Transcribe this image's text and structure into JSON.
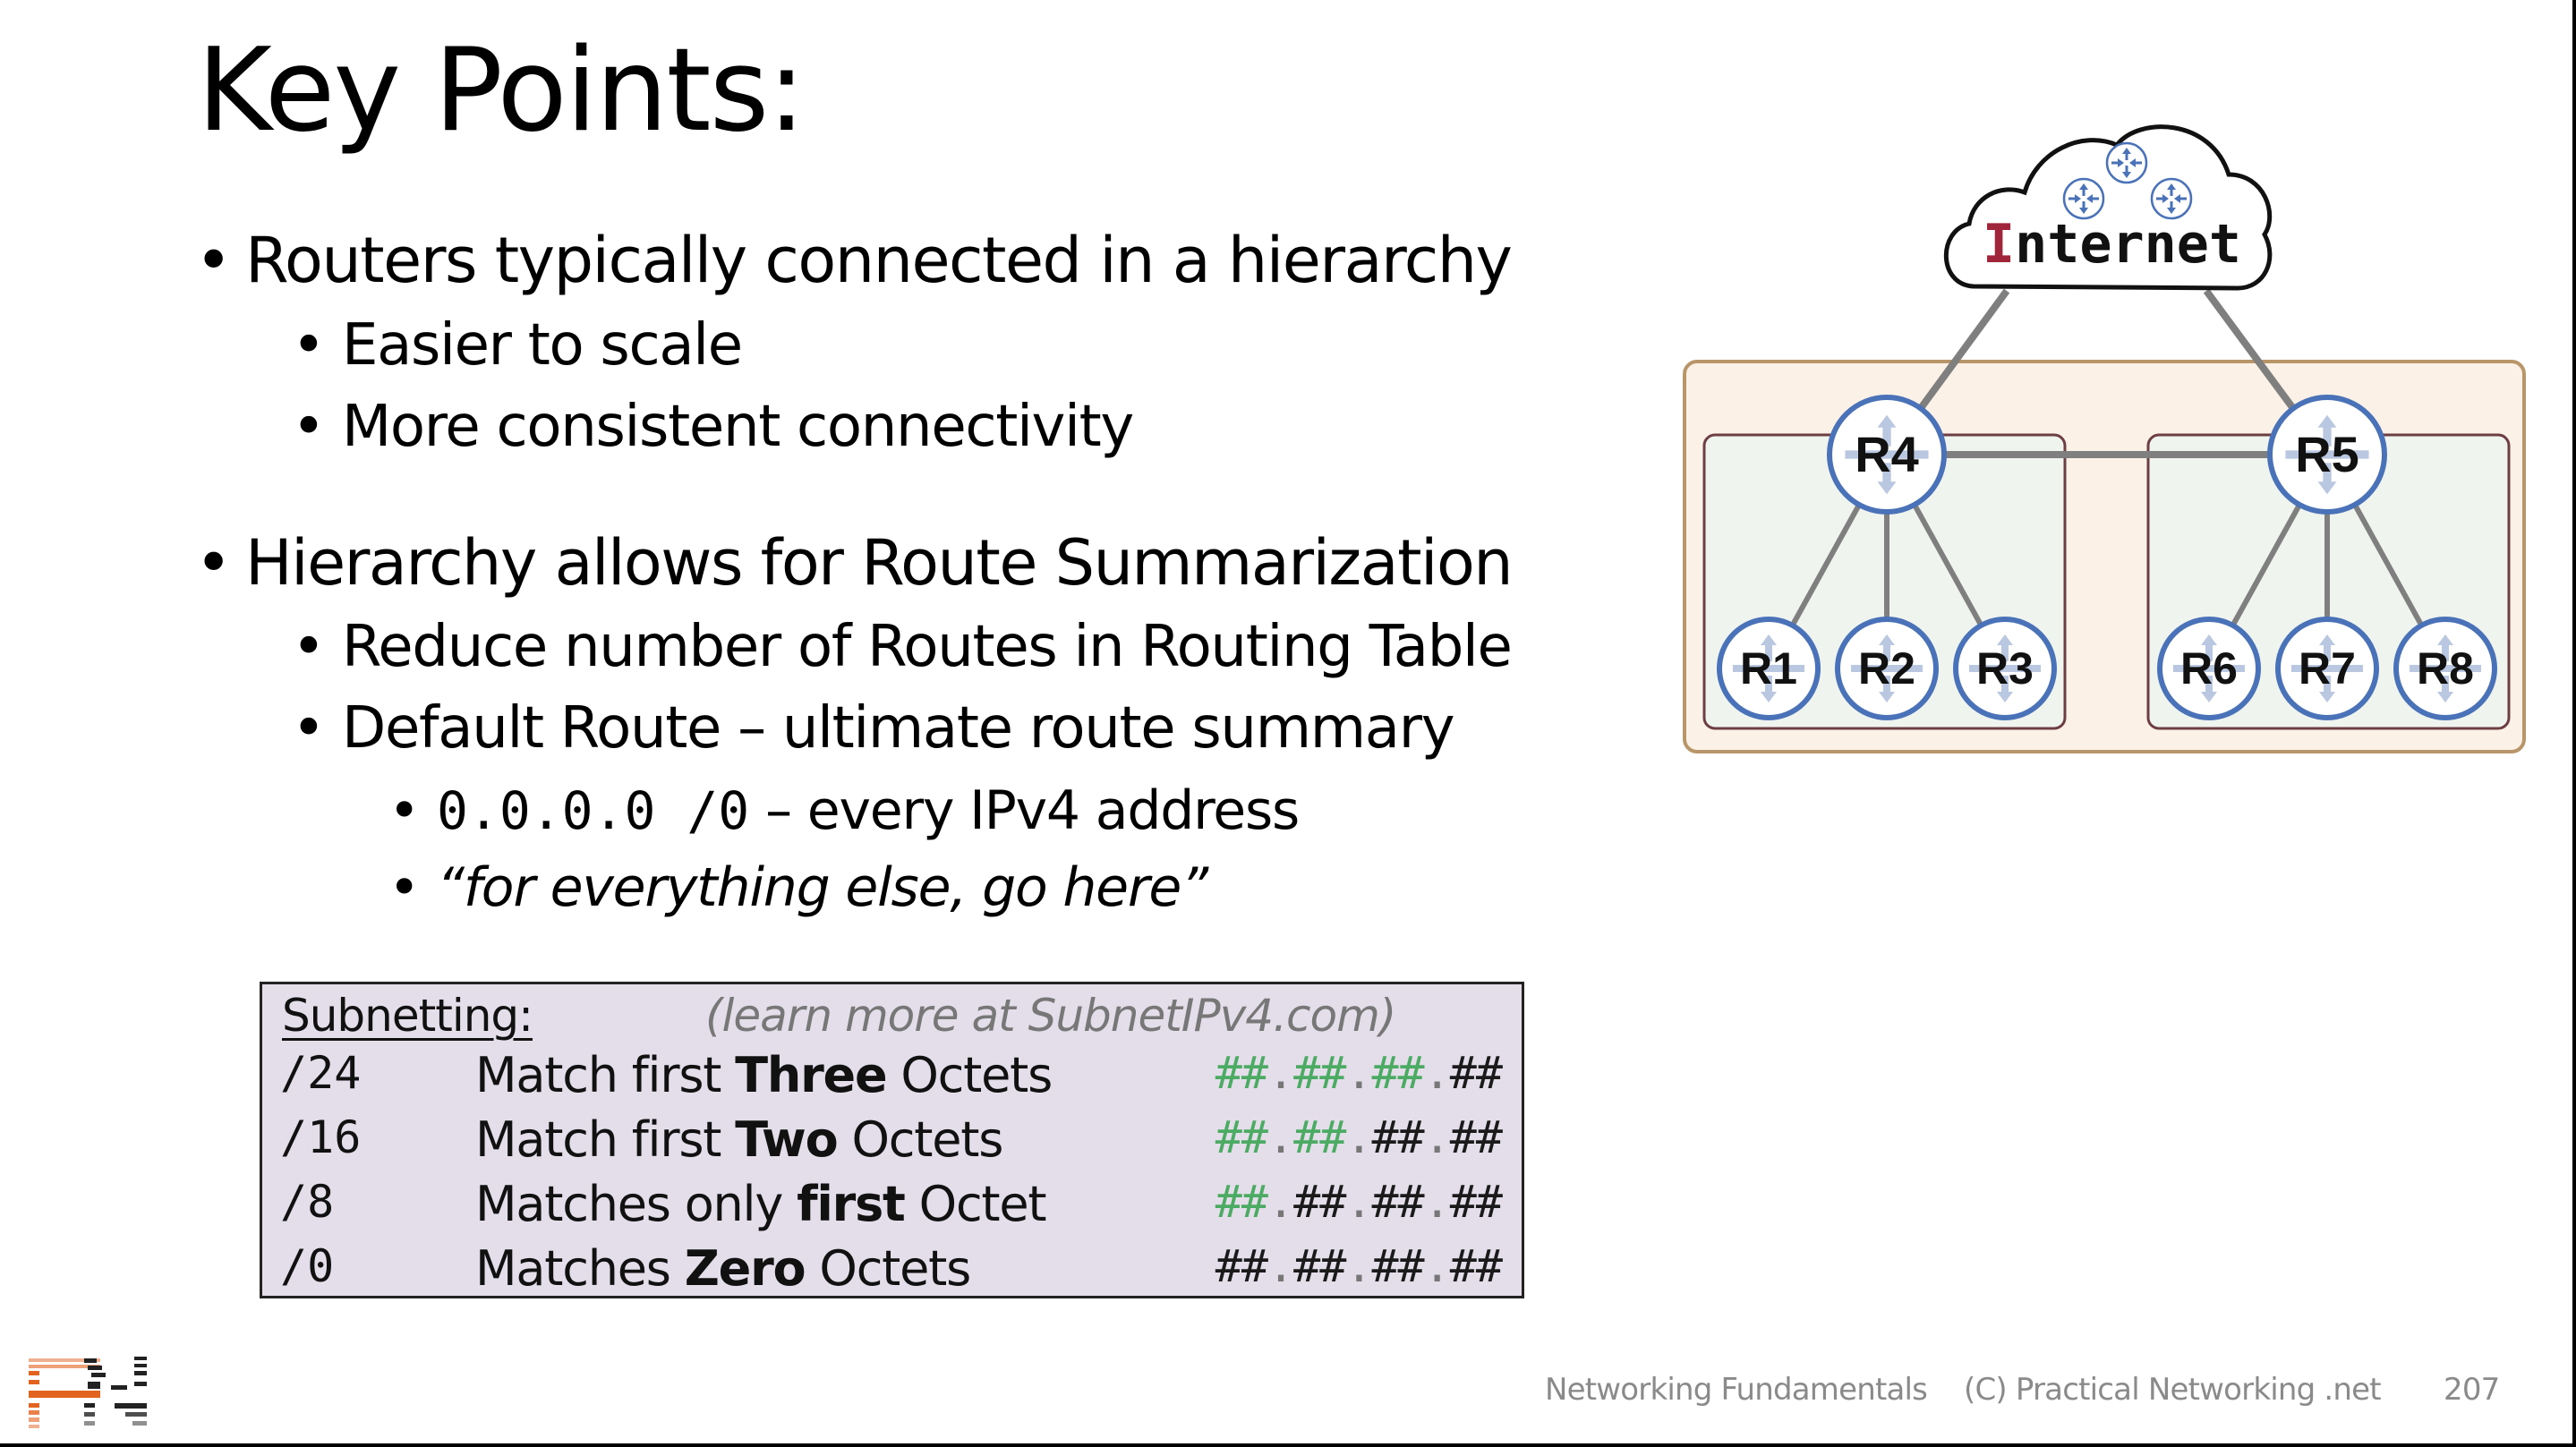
{
  "slide": {
    "title": "Key Points:",
    "bullets": [
      {
        "level": 1,
        "text": "Routers typically connected in a hierarchy"
      },
      {
        "level": 2,
        "text": "Easier to scale"
      },
      {
        "level": 2,
        "text": "More consistent connectivity"
      },
      {
        "level": 1,
        "text": "Hierarchy allows for Route Summarization"
      },
      {
        "level": 2,
        "text": "Reduce number of Routes in Routing Table"
      },
      {
        "level": 2,
        "text": "Default Route – ultimate route summary"
      },
      {
        "level": 3,
        "mono": "0.0.0.0 /0",
        "text": " – every IPv4 address"
      },
      {
        "level": 3,
        "text": "“for everything else, go here”",
        "italic": true
      }
    ],
    "bullet_glyph": "•"
  },
  "subnetting": {
    "header": "Subnetting:",
    "learn_more": "(learn more at SubnetIPv4.com)",
    "rows": [
      {
        "cidr": "/24",
        "pre": "Match first ",
        "bold": "Three",
        "post": " Octets",
        "matched_octets": 3
      },
      {
        "cidr": "/16",
        "pre": "Match first ",
        "bold": "Two",
        "post": " Octets",
        "matched_octets": 2
      },
      {
        "cidr": " /8",
        "pre": "Matches only ",
        "bold": "first",
        "post": " Octet",
        "matched_octets": 1
      },
      {
        "cidr": " /0",
        "pre": "Matches ",
        "bold": "Zero",
        "post": " Octets",
        "matched_octets": 0
      }
    ],
    "octet_glyph": "##",
    "match_color": "#4CAB63"
  },
  "diagram": {
    "cloud_label_first": "I",
    "cloud_label_rest": "nternet",
    "cloud_label_accent": "#A0253A",
    "router_color": "#4A72B8",
    "link_color": "#7f7f7f",
    "outer_area": {
      "fill": "#FCF1E6",
      "stroke": "#B8966A"
    },
    "inner_area": {
      "fill": "#EFF4EE",
      "stroke": "#6E3E45"
    },
    "routers": [
      {
        "id": "R4",
        "tier": "distribution",
        "group": "left"
      },
      {
        "id": "R5",
        "tier": "distribution",
        "group": "right"
      },
      {
        "id": "R1",
        "tier": "access",
        "group": "left",
        "parent": "R4"
      },
      {
        "id": "R2",
        "tier": "access",
        "group": "left",
        "parent": "R4"
      },
      {
        "id": "R3",
        "tier": "access",
        "group": "left",
        "parent": "R4"
      },
      {
        "id": "R6",
        "tier": "access",
        "group": "right",
        "parent": "R5"
      },
      {
        "id": "R7",
        "tier": "access",
        "group": "right",
        "parent": "R5"
      },
      {
        "id": "R8",
        "tier": "access",
        "group": "right",
        "parent": "R5"
      }
    ],
    "links": [
      [
        "Internet",
        "R4"
      ],
      [
        "Internet",
        "R5"
      ],
      [
        "R4",
        "R5"
      ],
      [
        "R4",
        "R1"
      ],
      [
        "R4",
        "R2"
      ],
      [
        "R4",
        "R3"
      ],
      [
        "R5",
        "R6"
      ],
      [
        "R5",
        "R7"
      ],
      [
        "R5",
        "R8"
      ]
    ]
  },
  "footer": {
    "course": "Networking Fundamentals",
    "copyright": "(C) Practical Networking .net",
    "page_number": "207",
    "logo_label": "PN"
  }
}
